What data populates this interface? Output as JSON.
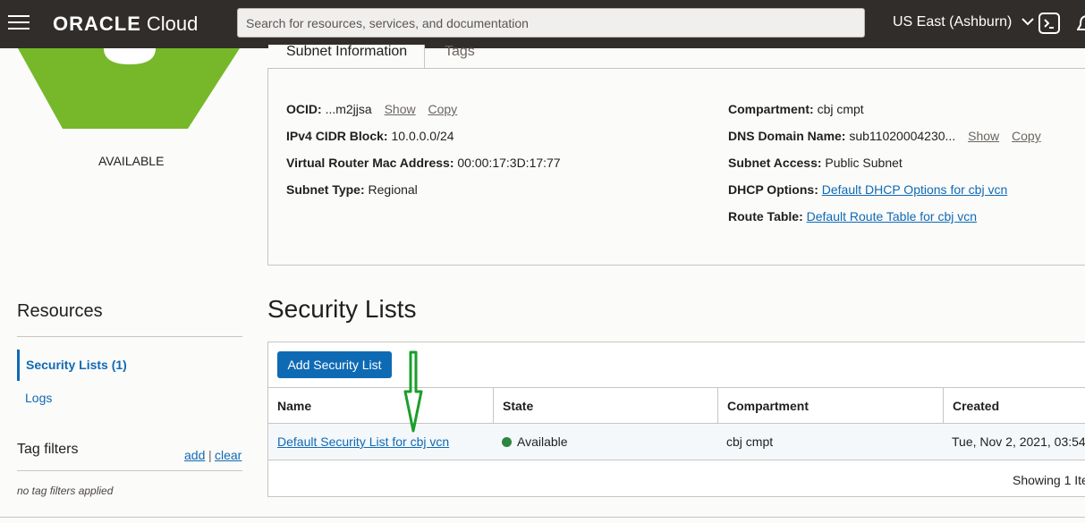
{
  "header": {
    "logo_brand": "ORACLE",
    "logo_product": "Cloud",
    "search_placeholder": "Search for resources, services, and documentation",
    "region": "US East (Ashburn)"
  },
  "status": {
    "label": "AVAILABLE",
    "color": "#76b82a"
  },
  "tabs": [
    {
      "label": "Subnet Information"
    },
    {
      "label": "Tags"
    }
  ],
  "subnet": {
    "ocid": {
      "label": "OCID:",
      "value": "...m2jjsa",
      "show": "Show",
      "copy": "Copy"
    },
    "cidr": {
      "label": "IPv4 CIDR Block:",
      "value": "10.0.0.0/24"
    },
    "mac": {
      "label": "Virtual Router Mac Address:",
      "value": "00:00:17:3D:17:77"
    },
    "type": {
      "label": "Subnet Type:",
      "value": "Regional"
    },
    "compartment": {
      "label": "Compartment:",
      "value": "cbj cmpt"
    },
    "dns": {
      "label": "DNS Domain Name:",
      "value": "sub11020004230...",
      "show": "Show",
      "copy": "Copy"
    },
    "access": {
      "label": "Subnet Access:",
      "value": "Public Subnet"
    },
    "dhcp": {
      "label": "DHCP Options:",
      "value": "Default DHCP Options for cbj vcn"
    },
    "route": {
      "label": "Route Table:",
      "value": "Default Route Table for cbj vcn"
    }
  },
  "resources": {
    "title": "Resources",
    "items": [
      {
        "label": "Security Lists (1)"
      },
      {
        "label": "Logs"
      }
    ]
  },
  "tag_filters": {
    "title": "Tag filters",
    "add": "add",
    "separator": "|",
    "clear": "clear",
    "empty": "no tag filters applied"
  },
  "security_lists": {
    "title": "Security Lists",
    "add_button": "Add Security List",
    "columns": [
      "Name",
      "State",
      "Compartment",
      "Created"
    ],
    "rows": [
      {
        "name": "Default Security List for cbj vcn",
        "state": "Available",
        "compartment": "cbj cmpt",
        "created": "Tue, Nov 2, 2021, 03:54"
      }
    ],
    "showing": "Showing 1 Ite"
  },
  "colors": {
    "accent": "#0f6ab4",
    "header_bg": "#312d2a",
    "available": "#2e8540",
    "arrow": "#1a9e2a"
  }
}
